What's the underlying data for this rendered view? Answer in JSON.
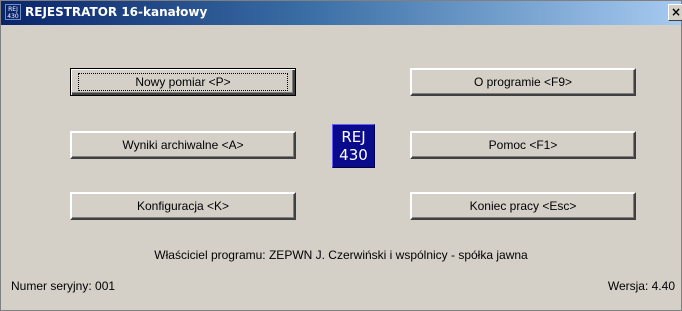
{
  "window": {
    "icon_text_line1": "REJ",
    "icon_text_line2": "430",
    "title": "REJESTRATOR 16-kanałowy",
    "close_glyph": "×"
  },
  "buttons": {
    "new_measurement": "Nowy pomiar  <P>",
    "archive_results": "Wyniki archiwalne  <A>",
    "configuration": "Konfiguracja  <K>",
    "about": "O programie  <F9>",
    "help": "Pomoc  <F1>",
    "exit": "Koniec pracy  <Esc>"
  },
  "logo": {
    "line1": "REJ",
    "line2": "430"
  },
  "footer": {
    "owner": "Właściciel programu: ZEPWN J. Czerwiński i wspólnicy - spółka jawna",
    "serial": "Numer seryjny: 001",
    "version": "Wersja: 4.40"
  }
}
